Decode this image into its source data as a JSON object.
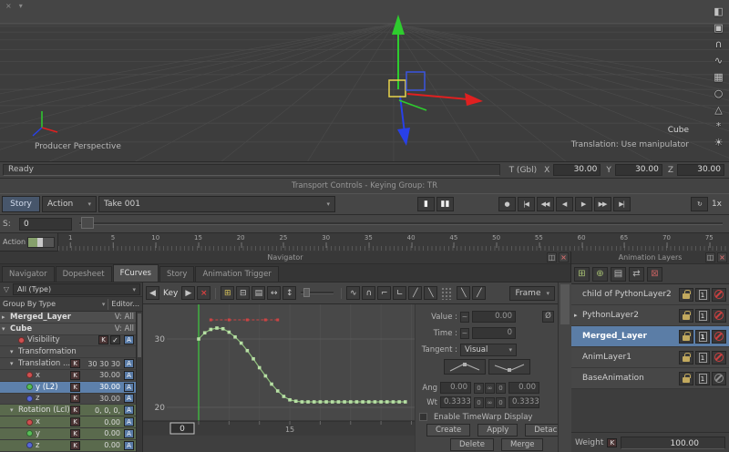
{
  "icons": {
    "chevron_down": "▾",
    "chevron_right": "▸",
    "close": "×",
    "dock": "◫",
    "filter": "▽",
    "tilde": "~",
    "zero_slash": "Ø",
    "check": "✓"
  },
  "viewport": {
    "camera_label": "Producer Perspective",
    "object_label": "Cube",
    "manipulator_label": "Translation: Use manipulator",
    "menu_icons": [
      {
        "name": "viewport-close",
        "glyph": "×"
      },
      {
        "name": "viewport-menu",
        "glyph": "▾"
      }
    ],
    "tool_icons": [
      {
        "name": "view-layout",
        "glyph": "◧"
      },
      {
        "name": "cube-tool",
        "glyph": "▣"
      },
      {
        "name": "magnet-tool",
        "glyph": "∩"
      },
      {
        "name": "curve-tool",
        "glyph": "∿"
      },
      {
        "name": "grid-toggle",
        "glyph": "▦"
      },
      {
        "name": "sphere-tool",
        "glyph": "○"
      },
      {
        "name": "cone-tool",
        "glyph": "△"
      },
      {
        "name": "sn ap-tool",
        "glyph": "*"
      },
      {
        "name": "light-toggle",
        "glyph": "☀"
      }
    ]
  },
  "status_bar": {
    "message": "Ready",
    "group_label": "T (Gbl)",
    "axes": [
      {
        "label": "X",
        "value": "30.00"
      },
      {
        "label": "Y",
        "value": "30.00"
      },
      {
        "label": "Z",
        "value": "30.00"
      }
    ]
  },
  "transport": {
    "header": "Transport Controls  -  Keying Group: TR",
    "story_label": "Story",
    "action_dropdown": "Action",
    "take_dropdown": "Take 001",
    "key_group": [
      {
        "name": "display-single",
        "glyph": "▮"
      },
      {
        "name": "display-double",
        "glyph": "▮▮"
      }
    ],
    "buttons": [
      {
        "name": "record",
        "glyph": "●"
      },
      {
        "name": "go-to-start",
        "glyph": "|◀"
      },
      {
        "name": "step-backward",
        "glyph": "◀◀"
      },
      {
        "name": "play-backward",
        "glyph": "◀"
      },
      {
        "name": "play",
        "glyph": "▶"
      },
      {
        "name": "step-forward",
        "glyph": "▶▶"
      },
      {
        "name": "go-to-end",
        "glyph": "▶|"
      }
    ],
    "loop": {
      "name": "loop",
      "glyph": "↻"
    },
    "speed_label": "1x",
    "s_label": "S:",
    "s_value": "0",
    "action_label": "Action",
    "ruler_ticks": [
      "1",
      "5",
      "10",
      "15",
      "20",
      "25",
      "30",
      "35",
      "40",
      "45",
      "50",
      "55",
      "60",
      "65",
      "70",
      "75"
    ]
  },
  "navigator": {
    "title": "Navigator",
    "tabs": [
      "Navigator",
      "Dopesheet",
      "FCurves",
      "Story",
      "Animation Trigger"
    ],
    "active_tab": "FCurves"
  },
  "tree": {
    "filter_value": "All (Type)",
    "group_by_label": "Group By Type",
    "editor_label": "Editor...",
    "rows": [
      {
        "label": "Merged_Layer",
        "arrow": "▸",
        "right_text": "V: All",
        "bold": true
      },
      {
        "label": "Cube",
        "arrow": "▾",
        "right_text": "V: All",
        "bold": true
      },
      {
        "label": "Visibility",
        "dot": "#d05050",
        "k": "K",
        "check": true,
        "a": "A",
        "indent": 1
      },
      {
        "label": "Transformation",
        "arrow": "▾",
        "indent": 1
      },
      {
        "label": "Translation ...",
        "arrow": "▾",
        "k": "K",
        "value": "30 30 30",
        "a": "A",
        "indent": 1
      },
      {
        "label": "x",
        "dot": "#d05050",
        "k": "K",
        "value": "30.00",
        "a": "A",
        "indent": 2
      },
      {
        "label": "y (L2)",
        "dot": "#58c058",
        "k": "K",
        "value": "30.00",
        "a": "A",
        "indent": 2,
        "selected": true
      },
      {
        "label": "z",
        "dot": "#5868d8",
        "k": "K",
        "value": "30.00",
        "a": "A",
        "indent": 2
      },
      {
        "label": "Rotation (Lcl)",
        "arrow": "▾",
        "k": "K",
        "value": "0, 0, 0,",
        "a": "A",
        "indent": 1,
        "green": true
      },
      {
        "label": "x",
        "dot": "#d05050",
        "k": "K",
        "value": "0.00",
        "a": "A",
        "indent": 2,
        "green": true
      },
      {
        "label": "y",
        "dot": "#58c058",
        "k": "K",
        "value": "0.00",
        "a": "A",
        "indent": 2,
        "green": true
      },
      {
        "label": "z",
        "dot": "#5868d8",
        "k": "K",
        "value": "0.00",
        "a": "A",
        "indent": 2,
        "green": true
      }
    ]
  },
  "fcurve": {
    "toolbar": {
      "prev_key": {
        "name": "previous-key",
        "glyph": "◀"
      },
      "key_label": "Key",
      "next_key": {
        "name": "next-key",
        "glyph": "▶"
      },
      "delete_key": {
        "name": "delete-key",
        "glyph": "×"
      },
      "edit_icons": [
        {
          "name": "add-key",
          "glyph": "⊞"
        },
        {
          "name": "flatten-key",
          "glyph": "⊟"
        },
        {
          "name": "region-tool",
          "glyph": "▤"
        },
        {
          "name": "move-horizontal",
          "glyph": "↔"
        },
        {
          "name": "move-vertical",
          "glyph": "↕"
        }
      ],
      "tangent_icons": [
        {
          "name": "smooth-tangent",
          "glyph": "∿"
        },
        {
          "name": "auto-tangent",
          "glyph": "∩"
        },
        {
          "name": "flat-tangent",
          "glyph": "⌐"
        },
        {
          "name": "stepped-tangent",
          "glyph": "∟"
        },
        {
          "name": "linear-in-tangent",
          "glyph": "╱"
        },
        {
          "name": "linear-out-tangent",
          "glyph": "╲"
        }
      ],
      "infinity_icons": [
        {
          "name": "pre-infinity",
          "glyph": "╲"
        },
        {
          "name": "post-infinity",
          "glyph": "╱"
        }
      ],
      "frame_label": "Frame"
    },
    "graph": {
      "y_ticks": [
        {
          "value": 30,
          "label": "30"
        },
        {
          "value": 20,
          "label": "20"
        }
      ],
      "x_ticks": [
        {
          "frame": 15,
          "label": "15"
        }
      ],
      "frame_box_value": "0",
      "cursor_frame": 0,
      "curve_color": "#8fbf7c",
      "marker_color": "#b7e0a4",
      "red_overlay": {
        "from_frame": 2,
        "to_frame": 13,
        "value": 32.8,
        "color": "#cc4444",
        "marker_frames": [
          2,
          5,
          8,
          11,
          13
        ]
      },
      "curve_points": [
        [
          0,
          30
        ],
        [
          1,
          30.9
        ],
        [
          2,
          31.4
        ],
        [
          3,
          31.6
        ],
        [
          4,
          31.5
        ],
        [
          5,
          31.0
        ],
        [
          6,
          30.3
        ],
        [
          7,
          29.4
        ],
        [
          8,
          28.3
        ],
        [
          9,
          27.1
        ],
        [
          10,
          25.8
        ],
        [
          11,
          24.6
        ],
        [
          12,
          23.4
        ],
        [
          13,
          22.4
        ],
        [
          14,
          21.6
        ],
        [
          15,
          21.1
        ],
        [
          16,
          20.9
        ],
        [
          17,
          20.8
        ],
        [
          18,
          20.8
        ],
        [
          19,
          20.8
        ],
        [
          20,
          20.8
        ],
        [
          21,
          20.8
        ],
        [
          22,
          20.8
        ],
        [
          23,
          20.8
        ],
        [
          24,
          20.8
        ],
        [
          25,
          20.8
        ],
        [
          26,
          20.8
        ],
        [
          27,
          20.8
        ],
        [
          28,
          20.8
        ],
        [
          29,
          20.8
        ],
        [
          30,
          20.8
        ],
        [
          31,
          20.8
        ],
        [
          32,
          20.8
        ],
        [
          33,
          20.8
        ],
        [
          34,
          20.8
        ]
      ]
    },
    "properties": {
      "value_label": "Value :",
      "value": "0.00",
      "time_label": "Time :",
      "time": "0",
      "tangent_label": "Tangent :",
      "tangent_value": "Visual",
      "ang_label": "Ang",
      "ang_left": "0.00",
      "ang_right": "0.00",
      "wt_label": "Wt",
      "wt_left": "0.3333",
      "wt_right": "0.3333",
      "lock_icons": [
        "0",
        "∞",
        "0"
      ],
      "timewarp_label": "Enable TimeWarp Display",
      "buttons_row1": [
        "Create",
        "Apply",
        "Detach"
      ],
      "buttons_row2": [
        "Delete",
        "Merge"
      ]
    }
  },
  "layers": {
    "title": "Animation Layers",
    "toolbar_icons": [
      {
        "name": "new-layer",
        "glyph": "⊞",
        "tint": "green"
      },
      {
        "name": "new-child-layer",
        "glyph": "⊕",
        "tint": "green"
      },
      {
        "name": "duplicate-layer",
        "glyph": "▤",
        "tint": ""
      },
      {
        "name": "reorder-layer",
        "glyph": "⇄",
        "tint": ""
      },
      {
        "name": "delete-layer",
        "glyph": "⊠",
        "tint": "red"
      }
    ],
    "rows": [
      {
        "name": "child of PythonLayer2",
        "lock": true,
        "weight_tag": "1",
        "mute": "red"
      },
      {
        "name": "PythonLayer2",
        "arrow": true,
        "lock": true,
        "weight_tag": "1",
        "mute": "red"
      },
      {
        "name": "Merged_Layer",
        "selected": true,
        "lock": true,
        "weight_tag": "1",
        "mute": "red"
      },
      {
        "name": "AnimLayer1",
        "lock": true,
        "weight_tag": "1",
        "mute": "red"
      },
      {
        "name": "BaseAnimation",
        "lock": true,
        "weight_tag": "1",
        "mute": "gray"
      }
    ],
    "weight_label": "Weight",
    "k_label": "K",
    "weight_value": "100.00"
  }
}
